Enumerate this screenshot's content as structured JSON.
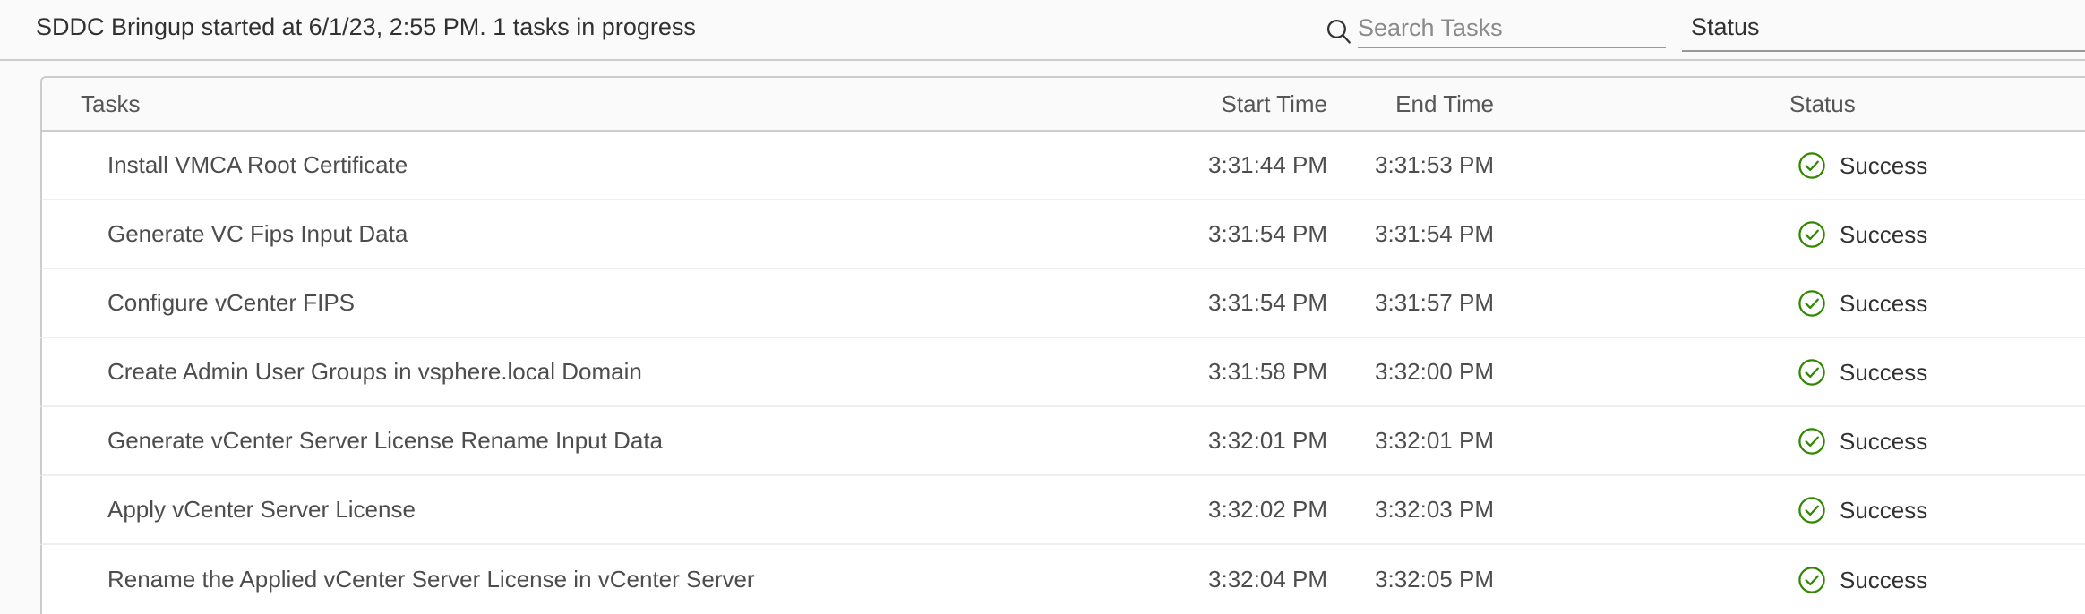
{
  "header": {
    "bringup_status": "SDDC Bringup started at 6/1/23, 2:55 PM. 1 tasks in progress",
    "search": {
      "icon": "search-icon",
      "placeholder": "Search Tasks",
      "value": ""
    },
    "status_filter": {
      "label": "Status",
      "icon": "chevron-down-icon"
    }
  },
  "table": {
    "columns": {
      "task": "Tasks",
      "start_time": "Start Time",
      "end_time": "End Time",
      "status": "Status"
    },
    "rows": [
      {
        "task": "Install VMCA Root Certificate",
        "start_time": "3:31:44 PM",
        "end_time": "3:31:53 PM",
        "status": "Success",
        "status_icon": "success-check-circle-icon"
      },
      {
        "task": "Generate VC Fips Input Data",
        "start_time": "3:31:54 PM",
        "end_time": "3:31:54 PM",
        "status": "Success",
        "status_icon": "success-check-circle-icon"
      },
      {
        "task": "Configure vCenter FIPS",
        "start_time": "3:31:54 PM",
        "end_time": "3:31:57 PM",
        "status": "Success",
        "status_icon": "success-check-circle-icon"
      },
      {
        "task": "Create Admin User Groups in vsphere.local Domain",
        "start_time": "3:31:58 PM",
        "end_time": "3:32:00 PM",
        "status": "Success",
        "status_icon": "success-check-circle-icon"
      },
      {
        "task": "Generate vCenter Server License Rename Input Data",
        "start_time": "3:32:01 PM",
        "end_time": "3:32:01 PM",
        "status": "Success",
        "status_icon": "success-check-circle-icon"
      },
      {
        "task": "Apply vCenter Server License",
        "start_time": "3:32:02 PM",
        "end_time": "3:32:03 PM",
        "status": "Success",
        "status_icon": "success-check-circle-icon"
      },
      {
        "task": "Rename the Applied vCenter Server License in vCenter Server",
        "start_time": "3:32:04 PM",
        "end_time": "3:32:05 PM",
        "status": "Success",
        "status_icon": "success-check-circle-icon"
      }
    ]
  },
  "colors": {
    "success_green": "#318700",
    "page_background": "#fafafa",
    "row_background": "#ffffff",
    "border": "#cccccc",
    "text_primary": "#313131",
    "text_secondary": "#4d4d4d",
    "placeholder": "#8a8a8a"
  }
}
